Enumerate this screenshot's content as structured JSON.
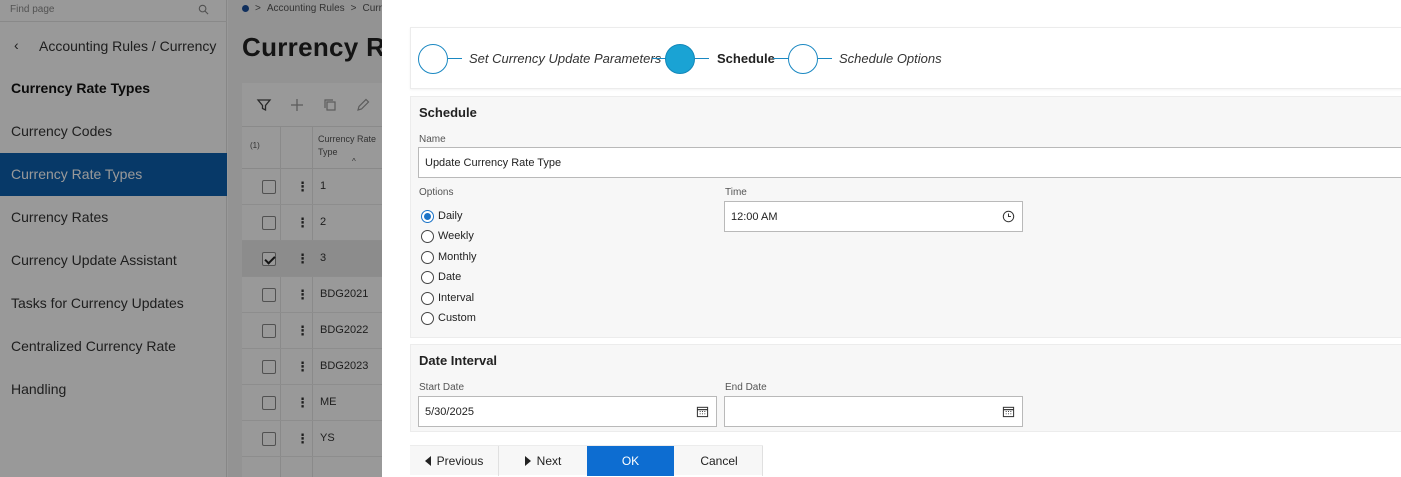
{
  "sidebar": {
    "find_placeholder": "Find page",
    "back_label": "Accounting Rules / Currency",
    "section_title": "Currency Rate Types",
    "items": [
      {
        "label": "Currency Codes",
        "active": false
      },
      {
        "label": "Currency Rate Types",
        "active": true
      },
      {
        "label": "Currency Rates",
        "active": false
      },
      {
        "label": "Currency Update Assistant",
        "active": false
      },
      {
        "label": "Tasks for Currency Updates",
        "active": false
      },
      {
        "label": "Centralized Currency Rate Handling",
        "active": false
      }
    ]
  },
  "breadcrumb": [
    "Accounting Rules",
    "Curre"
  ],
  "page": {
    "title": "Currency Ra"
  },
  "grid": {
    "selection_count": "(1)",
    "column_header_line1": "Currency Rate",
    "column_header_line2": "Type",
    "sort_caret": "^",
    "rows": [
      {
        "value": "1",
        "checked": false
      },
      {
        "value": "2",
        "checked": false
      },
      {
        "value": "3",
        "checked": true
      },
      {
        "value": "BDG2021",
        "checked": false
      },
      {
        "value": "BDG2022",
        "checked": false
      },
      {
        "value": "BDG2023",
        "checked": false
      },
      {
        "value": "ME",
        "checked": false
      },
      {
        "value": "YS",
        "checked": false
      }
    ]
  },
  "wizard": {
    "steps": [
      {
        "label": "Set Currency Update Parameters",
        "active": false
      },
      {
        "label": "Schedule",
        "active": true
      },
      {
        "label": "Schedule Options",
        "active": false
      }
    ]
  },
  "schedule": {
    "title": "Schedule",
    "name_label": "Name",
    "name_value": "Update Currency Rate Type",
    "options_label": "Options",
    "options": [
      {
        "label": "Daily",
        "selected": true
      },
      {
        "label": "Weekly",
        "selected": false
      },
      {
        "label": "Monthly",
        "selected": false
      },
      {
        "label": "Date",
        "selected": false
      },
      {
        "label": "Interval",
        "selected": false
      },
      {
        "label": "Custom",
        "selected": false
      }
    ],
    "time_label": "Time",
    "time_value": "12:00 AM"
  },
  "date_interval": {
    "title": "Date Interval",
    "start_label": "Start Date",
    "start_value": "5/30/2025",
    "end_label": "End Date",
    "end_value": ""
  },
  "buttons": {
    "previous": "Previous",
    "next": "Next",
    "ok": "OK",
    "cancel": "Cancel"
  },
  "colors": {
    "nav_active": "#0d5fae",
    "step_active": "#1aa3d4",
    "primary_button": "#0d6dd1",
    "radio_selected": "#1a73c8"
  }
}
